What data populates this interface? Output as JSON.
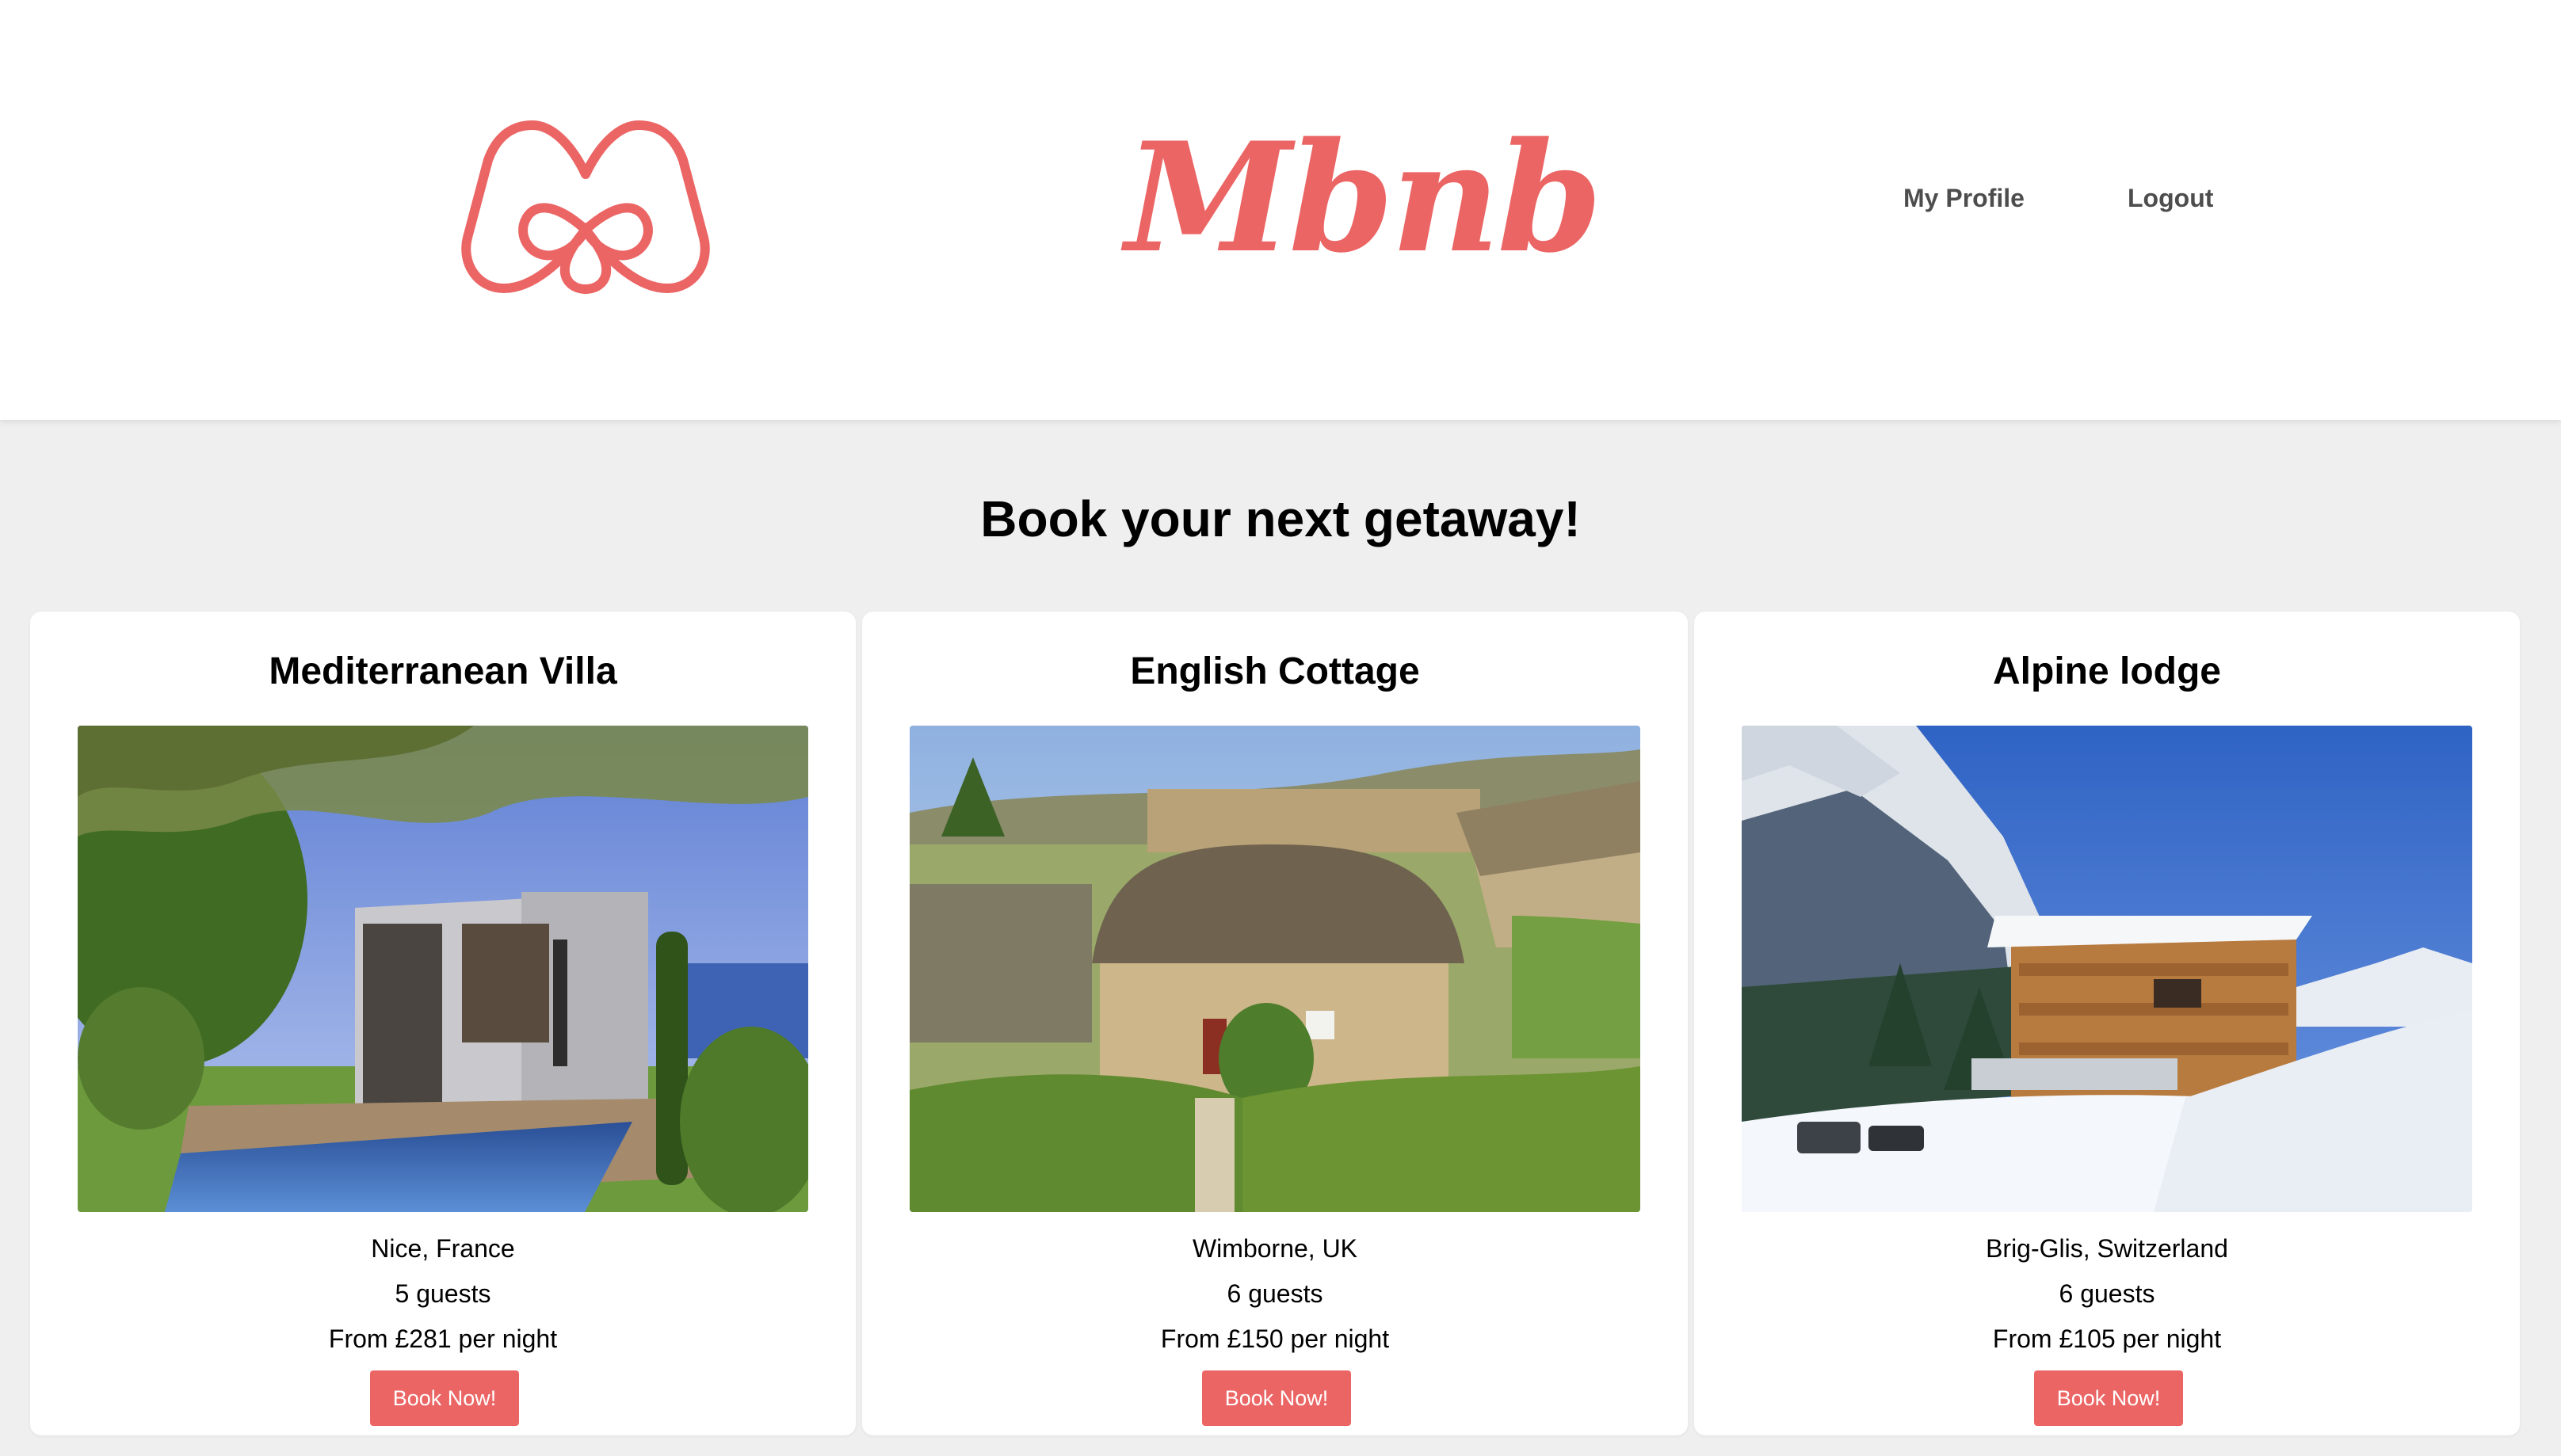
{
  "header": {
    "brand": "Mbnb",
    "nav": {
      "profile_label": "My Profile",
      "logout_label": "Logout"
    },
    "logo_icon": "airbnb-belo-icon"
  },
  "colors": {
    "accent": "#ec6565",
    "nav_text": "#4d4d4d",
    "page_bg": "#efefef",
    "card_bg": "#ffffff"
  },
  "main": {
    "heading": "Book your next getaway!",
    "listings": [
      {
        "title": "Mediterranean Villa",
        "location": "Nice, France",
        "guests": "5 guests",
        "price": "From £281 per night",
        "button_label": "Book Now!"
      },
      {
        "title": "English Cottage",
        "location": "Wimborne, UK",
        "guests": "6 guests",
        "price": "From £150 per night",
        "button_label": "Book Now!"
      },
      {
        "title": "Alpine lodge",
        "location": "Brig-Glis, Switzerland",
        "guests": "6 guests",
        "price": "From £105 per night",
        "button_label": "Book Now!"
      }
    ]
  }
}
